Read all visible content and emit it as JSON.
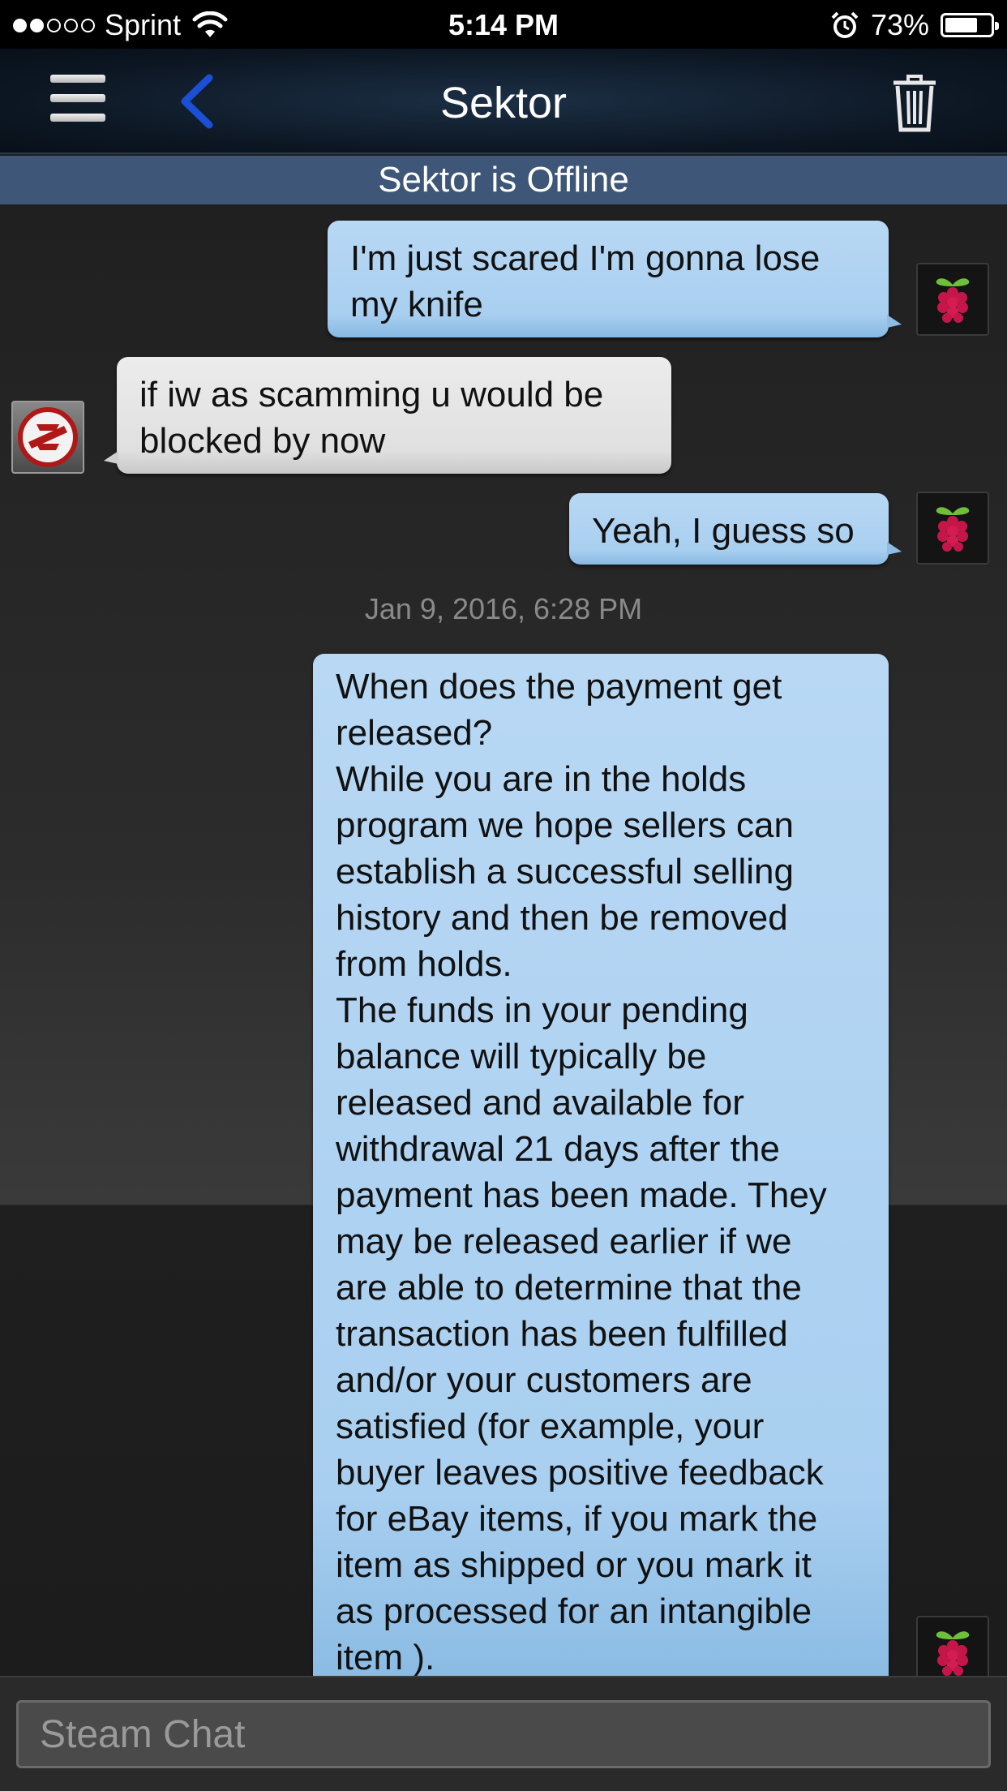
{
  "status_bar": {
    "carrier": "Sprint",
    "time": "5:14 PM",
    "battery": "73%",
    "battery_level": 0.73,
    "signal_bars": 2
  },
  "nav": {
    "title": "Sektor",
    "menu_icon": "hamburger-menu-icon",
    "back_icon": "chevron-left-icon",
    "trash_icon": "trash-icon",
    "back_color": "#1a4fd6"
  },
  "offline_banner": "Sektor is Offline",
  "messages": [
    {
      "direction": "out",
      "text": "I'm just scared I'm gonna lose my knife"
    },
    {
      "direction": "in",
      "text": "if iw as scamming u would be blocked by now"
    },
    {
      "direction": "out",
      "text": "Yeah, I guess so"
    },
    {
      "timestamp": "Jan 9, 2016, 6:28 PM"
    },
    {
      "direction": "out",
      "lines": [
        "When does the payment get",
        "released?",
        "While you are in the holds",
        "program we hope sellers can",
        "establish a successful selling",
        "history and then be removed",
        "from holds.",
        "The funds in your pending",
        "balance will typically be",
        "released and available for",
        "withdrawal 21 days after the",
        "payment has been made. They",
        "may be released earlier if we",
        "are able to determine that the",
        "transaction has been fulfilled",
        "and/or your customers are",
        "satisfied (for example, your",
        "buyer leaves positive feedback",
        "for eBay items, if you mark the",
        "item as shipped or you mark it",
        "as processed for an intangible",
        "item )."
      ]
    }
  ],
  "input": {
    "placeholder": "Steam Chat",
    "value": ""
  },
  "colors": {
    "outgoing_bubble": "#a9cff0",
    "incoming_bubble": "#e0e0e0",
    "offline_banner": "#3e5677"
  }
}
